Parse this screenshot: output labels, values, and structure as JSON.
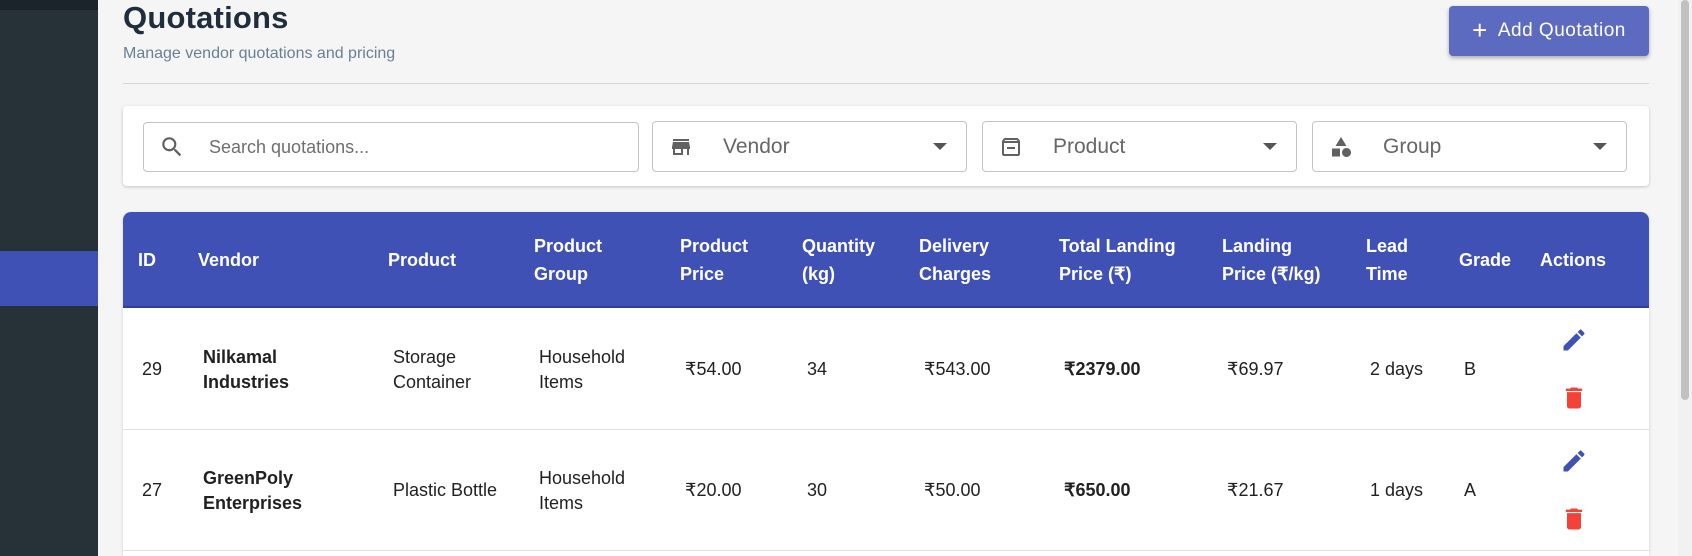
{
  "header": {
    "title": "Quotations",
    "subtitle": "Manage vendor quotations and pricing",
    "add_button_label": "Add Quotation"
  },
  "filters": {
    "search_placeholder": "Search quotations...",
    "vendor_label": "Vendor",
    "product_label": "Product",
    "group_label": "Group"
  },
  "table": {
    "columns": [
      "ID",
      "Vendor",
      "Product",
      "Product Group",
      "Product Price",
      "Quantity (kg)",
      "Delivery Charges",
      "Total Landing Price (₹)",
      "Landing Price (₹/kg)",
      "Lead Time",
      "Grade",
      "Actions"
    ],
    "rows": [
      {
        "id": "29",
        "vendor": "Nilkamal Industries",
        "product": "Storage Container",
        "group": "Household Items",
        "price": "₹54.00",
        "quantity": "34",
        "delivery": "₹543.00",
        "total": "₹2379.00",
        "landing": "₹69.97",
        "lead_time": "2 days",
        "grade": "B"
      },
      {
        "id": "27",
        "vendor": "GreenPoly Enterprises",
        "product": "Plastic Bottle",
        "group": "Household Items",
        "price": "₹20.00",
        "quantity": "30",
        "delivery": "₹50.00",
        "total": "₹650.00",
        "landing": "₹21.67",
        "lead_time": "1 days",
        "grade": "A"
      }
    ]
  },
  "colors": {
    "primary": "#3f51b5",
    "button": "#5c6bc0",
    "sidebar": "#263238",
    "edit_icon": "#3f51b5",
    "delete_icon": "#f44336"
  },
  "icons": {
    "search": "search-icon",
    "vendor": "store-icon",
    "product": "archive-icon",
    "group": "category-icon",
    "edit": "pencil-icon",
    "delete": "trash-icon"
  }
}
